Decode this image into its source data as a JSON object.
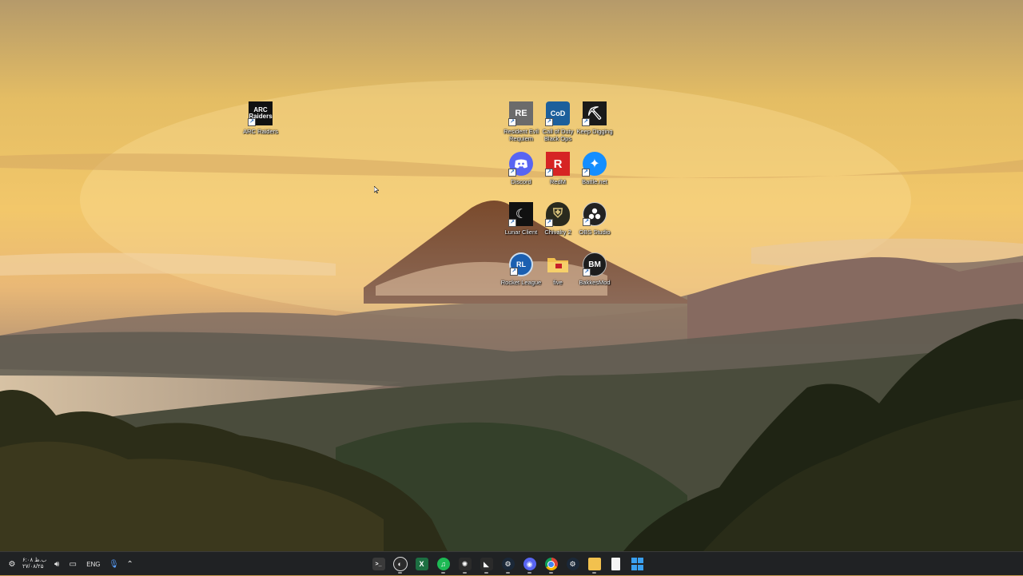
{
  "desktop": {
    "icons": [
      {
        "label": "ARC Raiders",
        "icon": "arc-raiders-icon",
        "glyph": "ARC",
        "bg": "#111111"
      },
      {
        "label": "Resident Evil Requiem",
        "icon": "resident-evil-icon",
        "glyph": "RE",
        "bg": "#6b6b6b"
      },
      {
        "label": "Call of Duty Black Ops",
        "icon": "call-of-duty-icon",
        "glyph": "CoD",
        "bg": "#1c5f9c"
      },
      {
        "label": "Keep Digging",
        "icon": "pickaxe-icon",
        "glyph": "⛏",
        "bg": "#1a1a1a"
      },
      {
        "label": "Discord",
        "icon": "discord-icon",
        "glyph": "◉",
        "bg": "#5865f2"
      },
      {
        "label": "RedM",
        "icon": "redm-icon",
        "glyph": "R",
        "bg": "#d62424"
      },
      {
        "label": "Battle.net",
        "icon": "battlenet-icon",
        "glyph": "✦",
        "bg": "#148eff"
      },
      {
        "label": "Lunar Client",
        "icon": "lunar-client-icon",
        "glyph": "☾",
        "bg": "#111111"
      },
      {
        "label": "Chivalry 2",
        "icon": "chivalry-icon",
        "glyph": "⛨",
        "bg": "#2a2a1e"
      },
      {
        "label": "OBS Studio",
        "icon": "obs-icon",
        "glyph": "●",
        "bg": "#222222"
      },
      {
        "label": "Rocket League",
        "icon": "rocket-league-icon",
        "glyph": "RL",
        "bg": "#1b5fb0"
      },
      {
        "label": "five",
        "icon": "folder-icon",
        "glyph": "",
        "bg": "#f2c14e"
      },
      {
        "label": "BakkesMod",
        "icon": "bakkesmod-icon",
        "glyph": "BM",
        "bg": "#1d1d1d"
      }
    ]
  },
  "taskbar": {
    "clock_time": "۶:۰۸ ب.ظ",
    "clock_date": "۲۷/۰۸/۲۵",
    "language": "ENG",
    "apps": [
      {
        "name": "Terminal",
        "icon": "terminal-icon",
        "glyph": ">_",
        "bg": "#3a3a3a",
        "running": false
      },
      {
        "name": "Game Bar",
        "icon": "game-bar-icon",
        "glyph": "◐",
        "bg": "#2b2b2b",
        "running": true
      },
      {
        "name": "Excel",
        "icon": "excel-icon",
        "glyph": "X",
        "bg": "#1d6f42",
        "running": false
      },
      {
        "name": "Spotify",
        "icon": "spotify-icon",
        "glyph": "♫",
        "bg": "#1db954",
        "running": true
      },
      {
        "name": "Overwolf",
        "icon": "overwolf-icon",
        "glyph": "✺",
        "bg": "#2b2b2b",
        "running": true
      },
      {
        "name": "Razer",
        "icon": "razer-icon",
        "glyph": "◣",
        "bg": "#2b2b2b",
        "running": true
      },
      {
        "name": "Steam",
        "icon": "steam-icon",
        "glyph": "⚙",
        "bg": "#1b2838",
        "running": true
      },
      {
        "name": "Discord",
        "icon": "discord-icon",
        "glyph": "◉",
        "bg": "#5865f2",
        "running": true
      },
      {
        "name": "Chrome",
        "icon": "chrome-icon",
        "glyph": "◎",
        "bg": "#db4437",
        "running": true
      },
      {
        "name": "Steam",
        "icon": "steam-icon",
        "glyph": "⚙",
        "bg": "#1b2838",
        "running": false
      },
      {
        "name": "File Explorer",
        "icon": "file-explorer-icon",
        "glyph": "▭",
        "bg": "#f2c14e",
        "running": true
      },
      {
        "name": "Notepad",
        "icon": "notepad-icon",
        "glyph": "▯",
        "bg": "#f4f4f4",
        "running": false
      },
      {
        "name": "Start",
        "icon": "windows-start-icon",
        "glyph": "⊞",
        "bg": "#0078d4",
        "running": false
      }
    ]
  }
}
